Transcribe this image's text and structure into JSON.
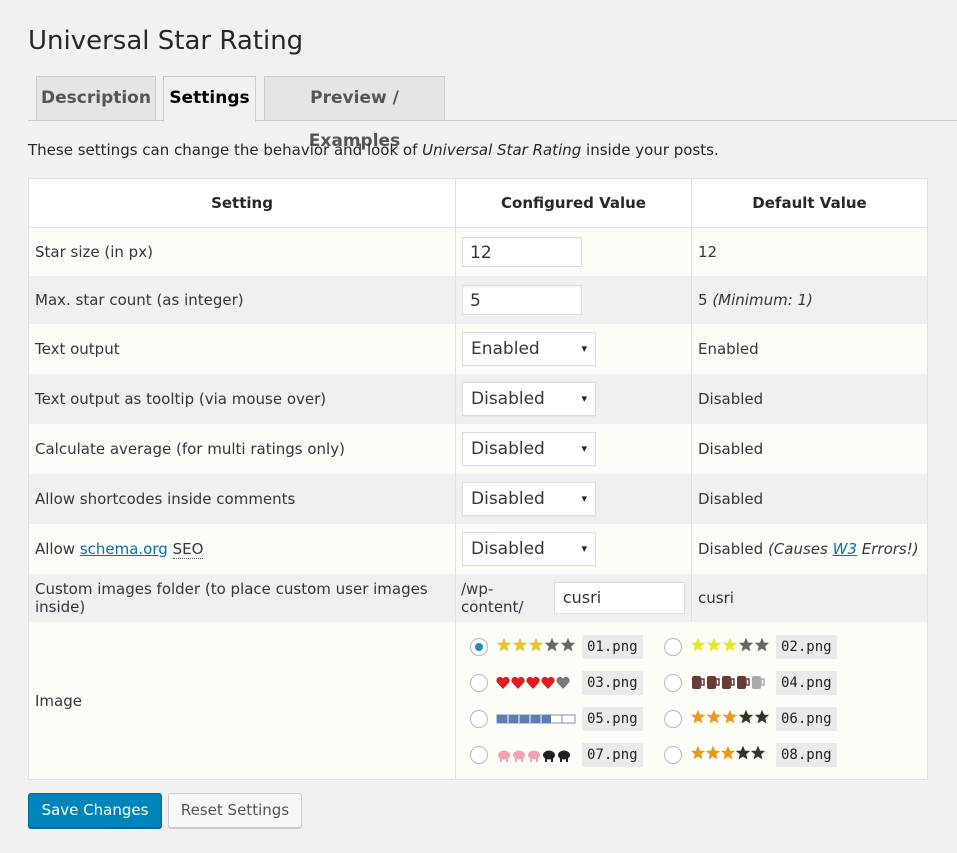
{
  "page": {
    "title": "Universal Star Rating",
    "intro_prefix": "These settings can change the behavior and look of ",
    "intro_plugin": "Universal Star Rating",
    "intro_suffix": " inside your posts."
  },
  "tabs": [
    {
      "label": "Description",
      "active": false
    },
    {
      "label": "Settings",
      "active": true
    },
    {
      "label": "Preview / Examples",
      "active": false
    }
  ],
  "table": {
    "headers": [
      "Setting",
      "Configured Value",
      "Default Value"
    ],
    "rows": {
      "star_size": {
        "label": "Star size (in px)",
        "value": "12",
        "default": "12"
      },
      "star_count": {
        "label": "Max. star count (as integer)",
        "value": "5",
        "default": "5",
        "default_note": "(Minimum: 1)"
      },
      "text_output": {
        "label": "Text output",
        "value": "Enabled",
        "default": "Enabled"
      },
      "tooltip": {
        "label": "Text output as tooltip (via mouse over)",
        "value": "Disabled",
        "default": "Disabled"
      },
      "average": {
        "label": "Calculate average (for multi ratings only)",
        "value": "Disabled",
        "default": "Disabled"
      },
      "shortcodes": {
        "label": "Allow shortcodes inside comments",
        "value": "Disabled",
        "default": "Disabled"
      },
      "schema": {
        "label_prefix": "Allow ",
        "label_link": "schema.org",
        "label_abbr": "SEO",
        "value": "Disabled",
        "default": "Disabled",
        "note_prefix": "(Causes ",
        "note_link": "W3",
        "note_suffix": " Errors!)"
      },
      "folder": {
        "label": "Custom images folder (to place custom user images inside)",
        "prefix": "/wp-content/",
        "value": "cusri",
        "default": "cusri"
      },
      "image": {
        "label": "Image"
      }
    },
    "images": [
      {
        "file": "01.png",
        "style": "gold-stars",
        "selected": true
      },
      {
        "file": "02.png",
        "style": "yellow-stars",
        "selected": false
      },
      {
        "file": "03.png",
        "style": "red-hearts",
        "selected": false
      },
      {
        "file": "04.png",
        "style": "mugs",
        "selected": false
      },
      {
        "file": "05.png",
        "style": "blue-bar",
        "selected": false
      },
      {
        "file": "06.png",
        "style": "orange-stars",
        "selected": false
      },
      {
        "file": "07.png",
        "style": "pink-pigs",
        "selected": false
      },
      {
        "file": "08.png",
        "style": "small-orange-stars",
        "selected": false
      }
    ],
    "arrow_glyph": "▾"
  },
  "buttons": {
    "save": "Save Changes",
    "reset": "Reset Settings"
  },
  "colors": {
    "accent": "#0085ba",
    "link": "#0073aa",
    "radio_on": "#1e8cbe"
  }
}
